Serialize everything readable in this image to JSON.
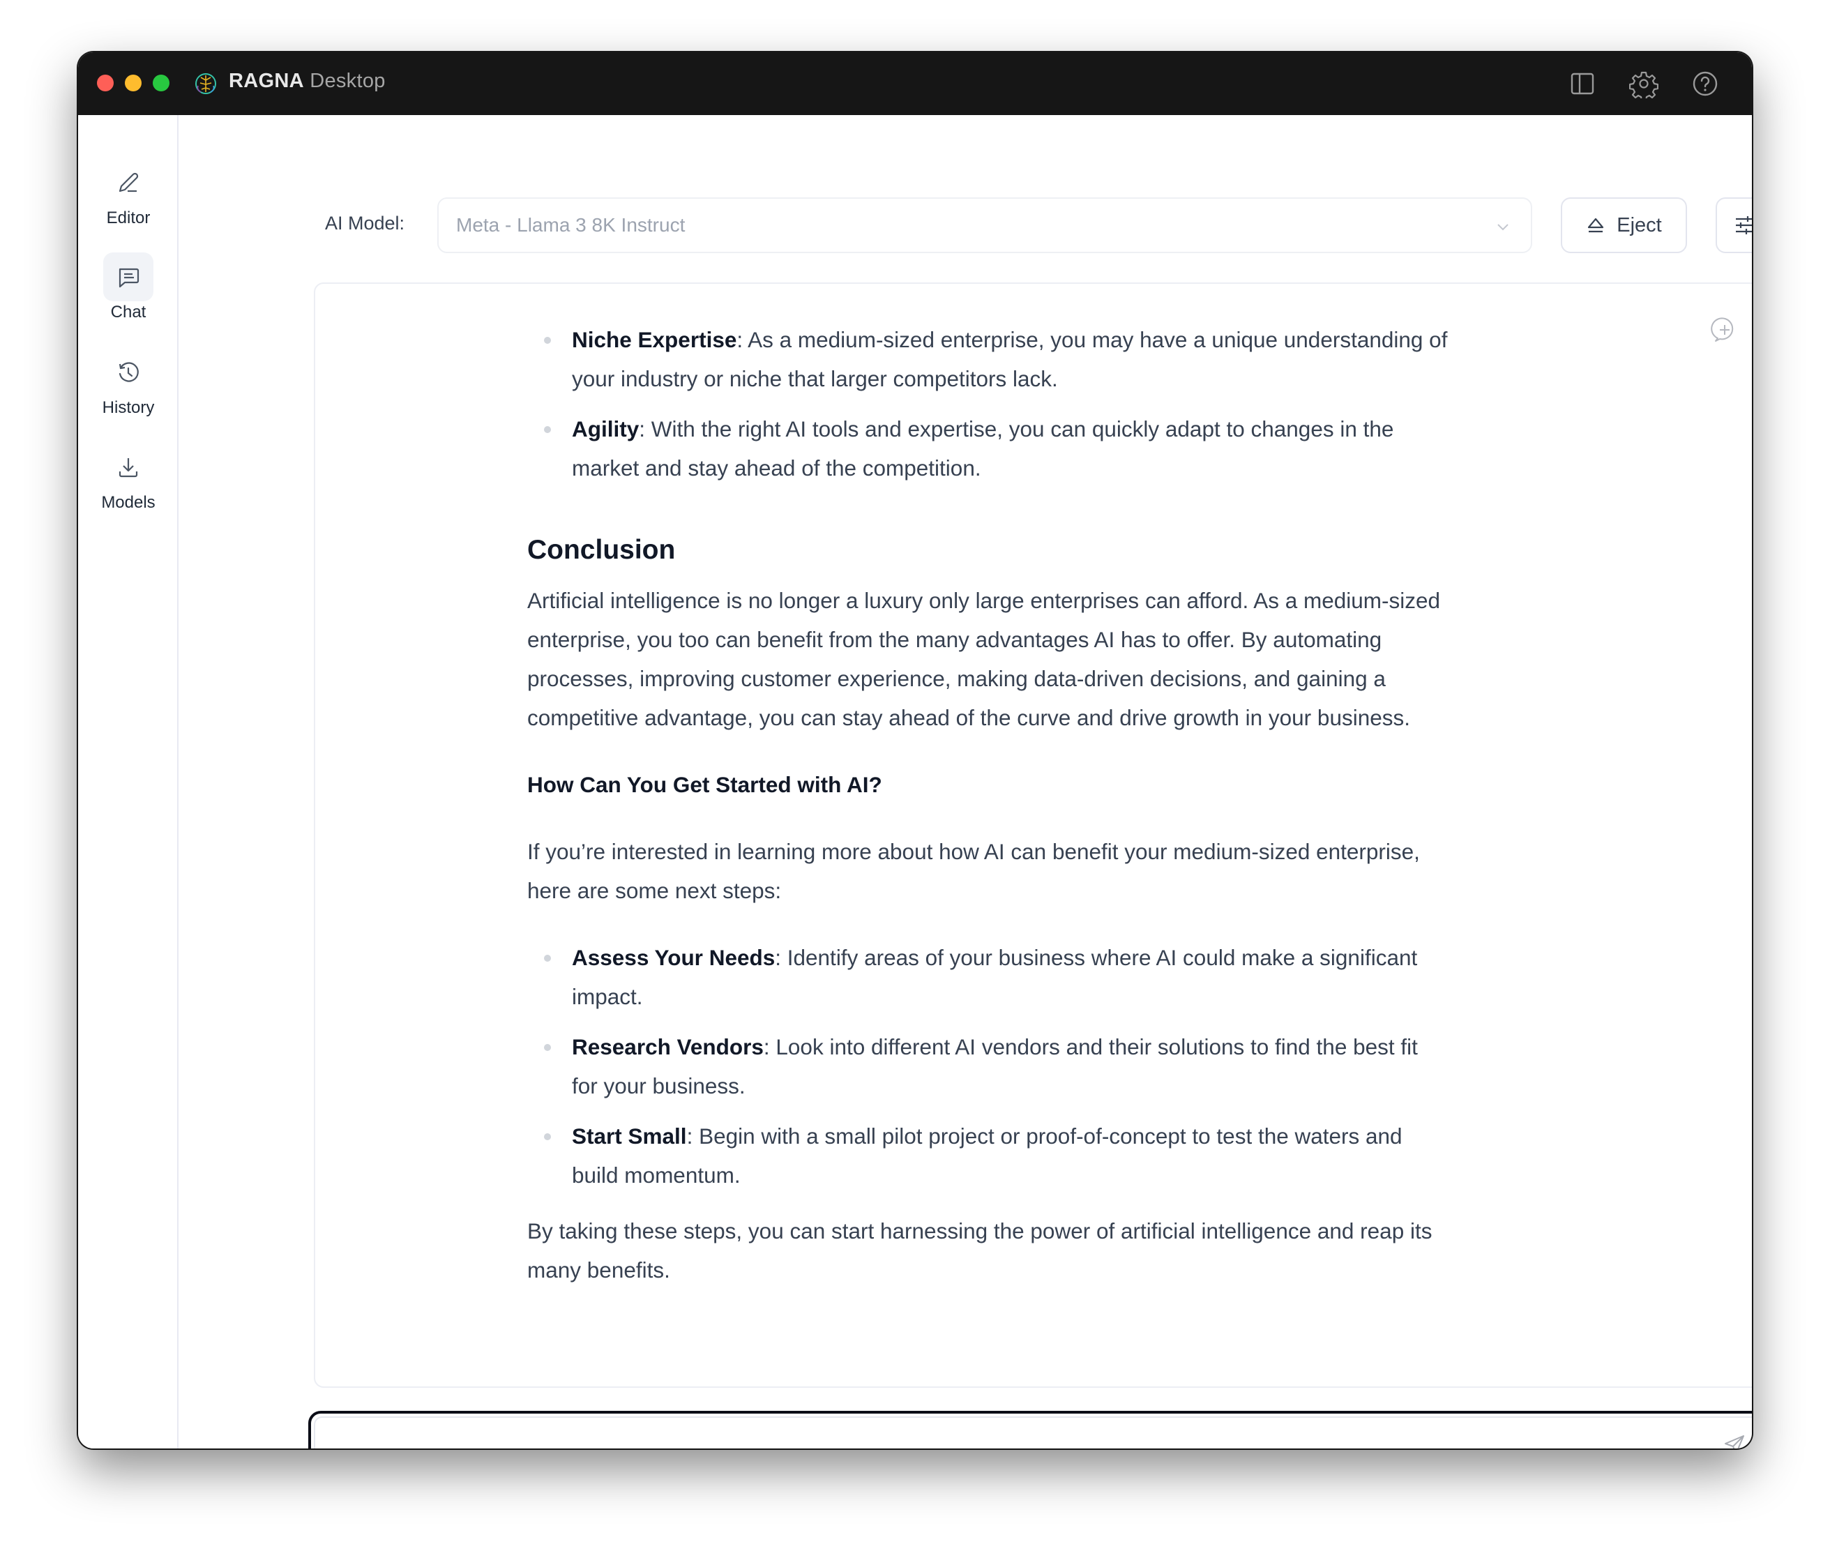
{
  "window": {
    "app_name_bold": "RAGNA",
    "app_name_light": "Desktop",
    "titlebar_icons": [
      "sidebar-toggle-icon",
      "gear-icon",
      "help-icon"
    ]
  },
  "sidebar": {
    "items": [
      {
        "label": "Editor",
        "icon": "pencil-icon",
        "active": false
      },
      {
        "label": "Chat",
        "icon": "chat-icon",
        "active": true
      },
      {
        "label": "History",
        "icon": "history-icon",
        "active": false
      },
      {
        "label": "Models",
        "icon": "download-icon",
        "active": false
      }
    ]
  },
  "toolbar": {
    "model_label": "AI Model:",
    "model_selected": "Meta - Llama 3 8K Instruct",
    "eject_label": "Eject"
  },
  "document": {
    "advantages": [
      {
        "term": "Niche Expertise",
        "text": ": As a medium-sized enterprise, you may have a unique understanding of your industry or niche that larger competitors lack."
      },
      {
        "term": "Agility",
        "text": ": With the right AI tools and expertise, you can quickly adapt to changes in the market and stay ahead of the competition."
      }
    ],
    "conclusion_heading": "Conclusion",
    "conclusion_text": "Artificial intelligence is no longer a luxury only large enterprises can afford. As a medium-sized enterprise, you too can benefit from the many advantages AI has to offer. By automating processes, improving customer experience, making data-driven decisions, and gaining a competitive advantage, you can stay ahead of the curve and drive growth in your business.",
    "getting_started_heading": "How Can You Get Started with AI?",
    "getting_started_intro": "If you’re interested in learning more about how AI can benefit your medium-sized enterprise, here are some next steps:",
    "steps": [
      {
        "term": "Assess Your Needs",
        "text": ": Identify areas of your business where AI could make a significant impact."
      },
      {
        "term": "Research Vendors",
        "text": ": Look into different AI vendors and their solutions to find the best fit for your business."
      },
      {
        "term": "Start Small",
        "text": ": Begin with a small pilot project or proof-of-concept to test the waters and build momentum."
      }
    ],
    "closing": "By taking these steps, you can start harnessing the power of artificial intelligence and reap its many benefits."
  },
  "chat_input": {
    "value": "",
    "placeholder": ""
  },
  "colors": {
    "titlebar_bg": "#161616",
    "traffic_red": "#fe5f57",
    "traffic_yellow": "#febc2e",
    "traffic_green": "#28c840",
    "text_body": "#374151",
    "text_strong": "#111827",
    "input_border": "#0b0d17"
  }
}
